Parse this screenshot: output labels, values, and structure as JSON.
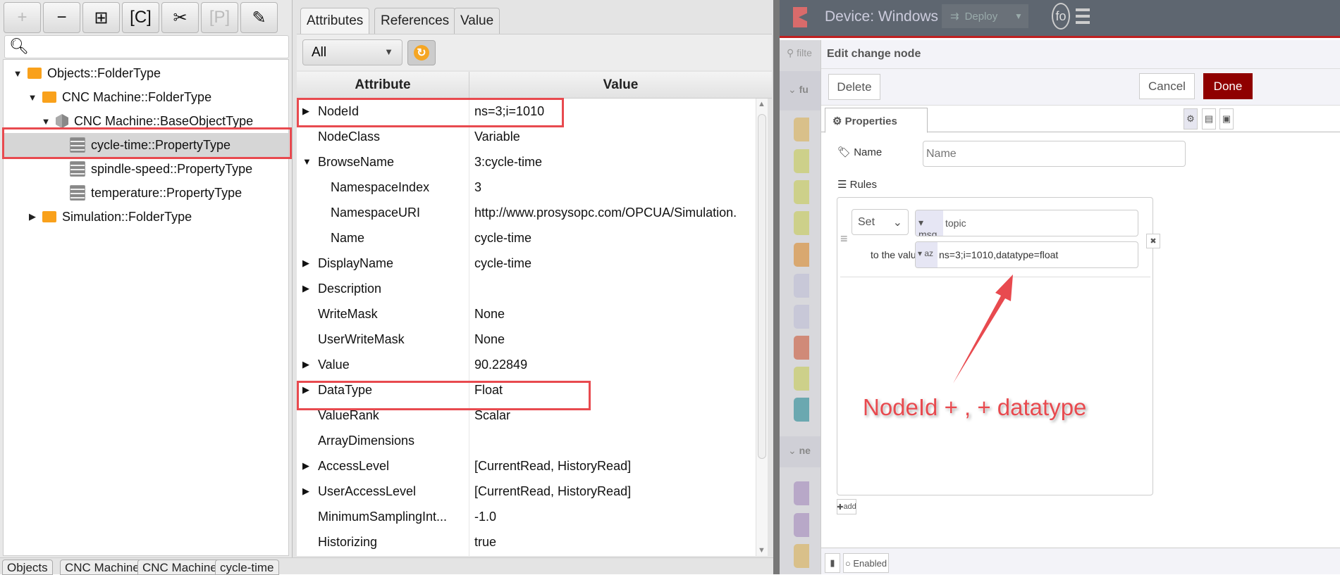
{
  "left": {
    "toolbar": [
      {
        "icon": "plus-icon",
        "glyph": "+"
      },
      {
        "icon": "minus-icon",
        "glyph": "−"
      },
      {
        "icon": "add-child-icon",
        "glyph": "⊞"
      },
      {
        "icon": "copy-icon",
        "glyph": "[C]"
      },
      {
        "icon": "cut-icon",
        "glyph": "✂"
      },
      {
        "icon": "paste-icon",
        "glyph": "[P]"
      },
      {
        "icon": "pencil-icon",
        "glyph": "✎"
      }
    ],
    "tree": [
      {
        "label": "Objects::FolderType",
        "icon": "folder",
        "expanded": true
      },
      {
        "label": "CNC Machine::FolderType",
        "icon": "folder",
        "expanded": true
      },
      {
        "label": "CNC Machine::BaseObjectType",
        "icon": "cube",
        "expanded": true
      },
      {
        "label": "cycle-time::PropertyType",
        "icon": "property",
        "selected": true
      },
      {
        "label": "spindle-speed::PropertyType",
        "icon": "property"
      },
      {
        "label": "temperature::PropertyType",
        "icon": "property"
      },
      {
        "label": "Simulation::FolderType",
        "icon": "folder",
        "expanded": false
      }
    ]
  },
  "middle": {
    "tabs": [
      "Attributes",
      "References",
      "Value"
    ],
    "filter": "All",
    "columns": [
      "Attribute",
      "Value"
    ],
    "rows": [
      {
        "attr": "NodeId",
        "value": "ns=3;i=1010",
        "exp": "right"
      },
      {
        "attr": "NodeClass",
        "value": "Variable"
      },
      {
        "attr": "BrowseName",
        "value": "3:cycle-time",
        "exp": "down"
      },
      {
        "attr": "NamespaceIndex",
        "value": "3",
        "child": true
      },
      {
        "attr": "NamespaceURI",
        "value": "http://www.prosysopc.com/OPCUA/Simulation.",
        "child": true
      },
      {
        "attr": "Name",
        "value": "cycle-time",
        "child": true
      },
      {
        "attr": "DisplayName",
        "value": "cycle-time",
        "exp": "right"
      },
      {
        "attr": "Description",
        "value": "",
        "exp": "right"
      },
      {
        "attr": "WriteMask",
        "value": "None"
      },
      {
        "attr": "UserWriteMask",
        "value": "None"
      },
      {
        "attr": "Value",
        "value": "90.22849",
        "exp": "right"
      },
      {
        "attr": "DataType",
        "value": "Float",
        "exp": "right"
      },
      {
        "attr": "ValueRank",
        "value": "Scalar"
      },
      {
        "attr": "ArrayDimensions",
        "value": ""
      },
      {
        "attr": "AccessLevel",
        "value": "[CurrentRead, HistoryRead]",
        "exp": "right"
      },
      {
        "attr": "UserAccessLevel",
        "value": "[CurrentRead, HistoryRead]",
        "exp": "right"
      },
      {
        "attr": "MinimumSamplingInt...",
        "value": "-1.0"
      },
      {
        "attr": "Historizing",
        "value": "true"
      }
    ],
    "breadcrumb": [
      "Objects",
      "CNC Machine",
      "CNC Machine",
      "cycle-time"
    ]
  },
  "nodered": {
    "title": "Device: Windows",
    "deploy": "Deploy",
    "avatar": "fo",
    "palette_filter": "filte",
    "palette_sections": [
      "fu",
      "ne"
    ],
    "edit_title": "Edit change node",
    "delete": "Delete",
    "cancel": "Cancel",
    "done": "Done",
    "tab": "Properties",
    "name_label": "Name",
    "name_placeholder": "Name",
    "rules_label": "Rules",
    "rule": {
      "action": "Set",
      "prop_prefix": "msg.",
      "prop": "topic",
      "to_label": "to the value",
      "type_glyph": "az",
      "value": "ns=3;i=1010,datatype=float"
    },
    "add": "add",
    "enabled": "Enabled",
    "accent": "#8f0000"
  },
  "annotation": {
    "text": "NodeId + , + datatype",
    "color": "#e84a4f"
  }
}
